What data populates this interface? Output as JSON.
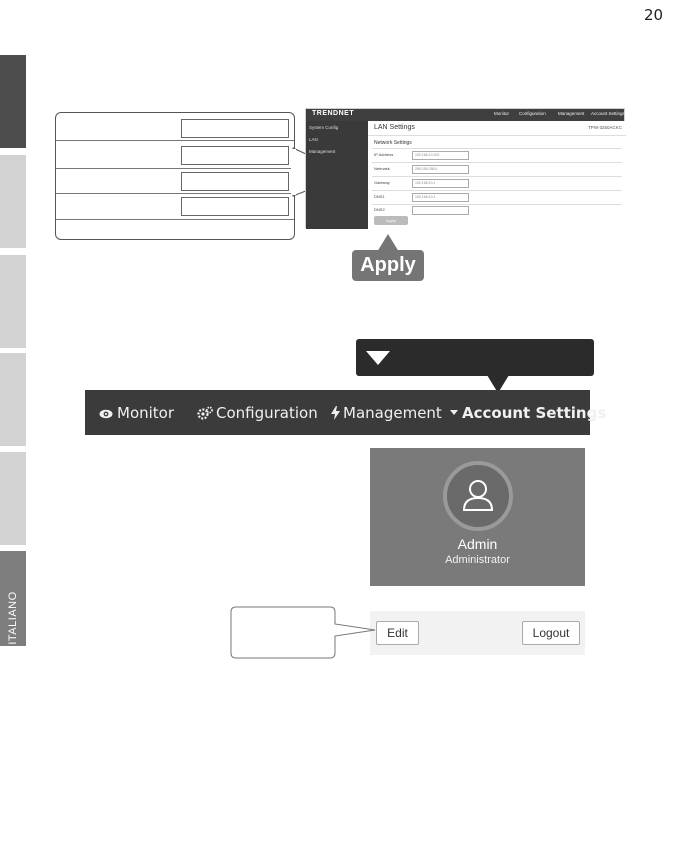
{
  "page_number": "20",
  "side_tabs": [
    {
      "label": ""
    },
    {
      "label": ""
    },
    {
      "label": ""
    },
    {
      "label": ""
    },
    {
      "label": ""
    },
    {
      "label": "ITALIANO"
    }
  ],
  "web_ui": {
    "logo": "TRENDNET",
    "nav": [
      "Monitor",
      "Configuration",
      "Management",
      "Account Settings"
    ],
    "sidebar": [
      "System Config",
      "LAN",
      "Management"
    ],
    "title": "LAN Settings",
    "model": "TPW-3250ACKC",
    "section": "Network Settings",
    "fields": [
      {
        "label": "IP Address",
        "value": "192.168.10.100"
      },
      {
        "label": "Netmask",
        "value": "255.255.255.0"
      },
      {
        "label": "Gateway",
        "value": "192.168.10.1"
      },
      {
        "label": "DNS1",
        "value": "192.168.10.1"
      },
      {
        "label": "DNS2",
        "value": ""
      }
    ],
    "apply_label": "Apply"
  },
  "apply_badge": "Apply",
  "navbar": {
    "items": [
      {
        "icon": "eye-icon",
        "label": "Monitor"
      },
      {
        "icon": "gears-icon",
        "label": "Configuration"
      },
      {
        "icon": "bolt-icon",
        "label": "Management"
      },
      {
        "icon": "caret-down-icon",
        "label": "Account Settings"
      }
    ]
  },
  "admin_card": {
    "name": "Admin",
    "role": "Administrator"
  },
  "buttons": {
    "edit": "Edit",
    "logout": "Logout"
  },
  "colors": {
    "dark_tab": "#4d4d4d",
    "current_tab": "#7d7d7d",
    "light_tab": "#d2d2d2",
    "navbar_bg": "#3b3b3b",
    "card_bg": "#7a7a7a",
    "badge_bg": "#757575"
  }
}
